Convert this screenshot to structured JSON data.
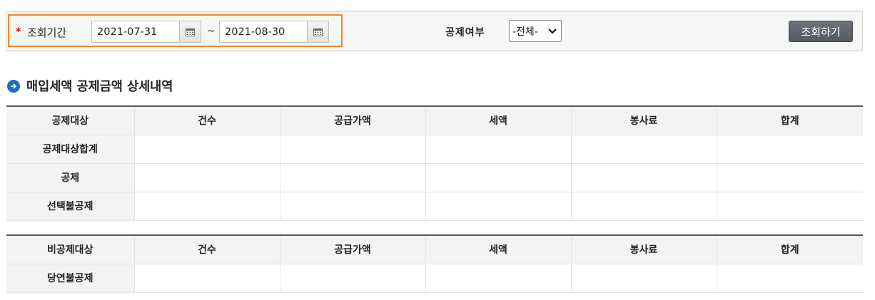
{
  "search": {
    "required_mark": "*",
    "period_label": "조회기간",
    "start_date": "2021-07-31",
    "end_date": "2021-08-30",
    "tilde": "~",
    "deduct_label": "공제여부",
    "deduct_selected": "-전체-",
    "search_button": "조회하기"
  },
  "section": {
    "title": "매입세액 공제금액 상세내역"
  },
  "table1": {
    "headers": [
      "공제대상",
      "건수",
      "공급가액",
      "세액",
      "봉사료",
      "합계"
    ],
    "rows": [
      {
        "label": "공제대상합계",
        "cells": [
          "",
          "",
          "",
          "",
          ""
        ]
      },
      {
        "label": "공제",
        "cells": [
          "",
          "",
          "",
          "",
          ""
        ]
      },
      {
        "label": "선택불공제",
        "cells": [
          "",
          "",
          "",
          "",
          ""
        ]
      }
    ]
  },
  "table2": {
    "headers": [
      "비공제대상",
      "건수",
      "공급가액",
      "세액",
      "봉사료",
      "합계"
    ],
    "rows": [
      {
        "label": "당연불공제",
        "cells": [
          "",
          "",
          "",
          "",
          ""
        ]
      }
    ]
  },
  "colors": {
    "highlight_border": "#f0882a",
    "required": "#d0021b",
    "button_bg": "#5f646a",
    "section_icon": "#1f6fb5"
  },
  "icons": [
    "calendar-icon",
    "arrow-right-circle-icon",
    "chevron-down-icon"
  ]
}
